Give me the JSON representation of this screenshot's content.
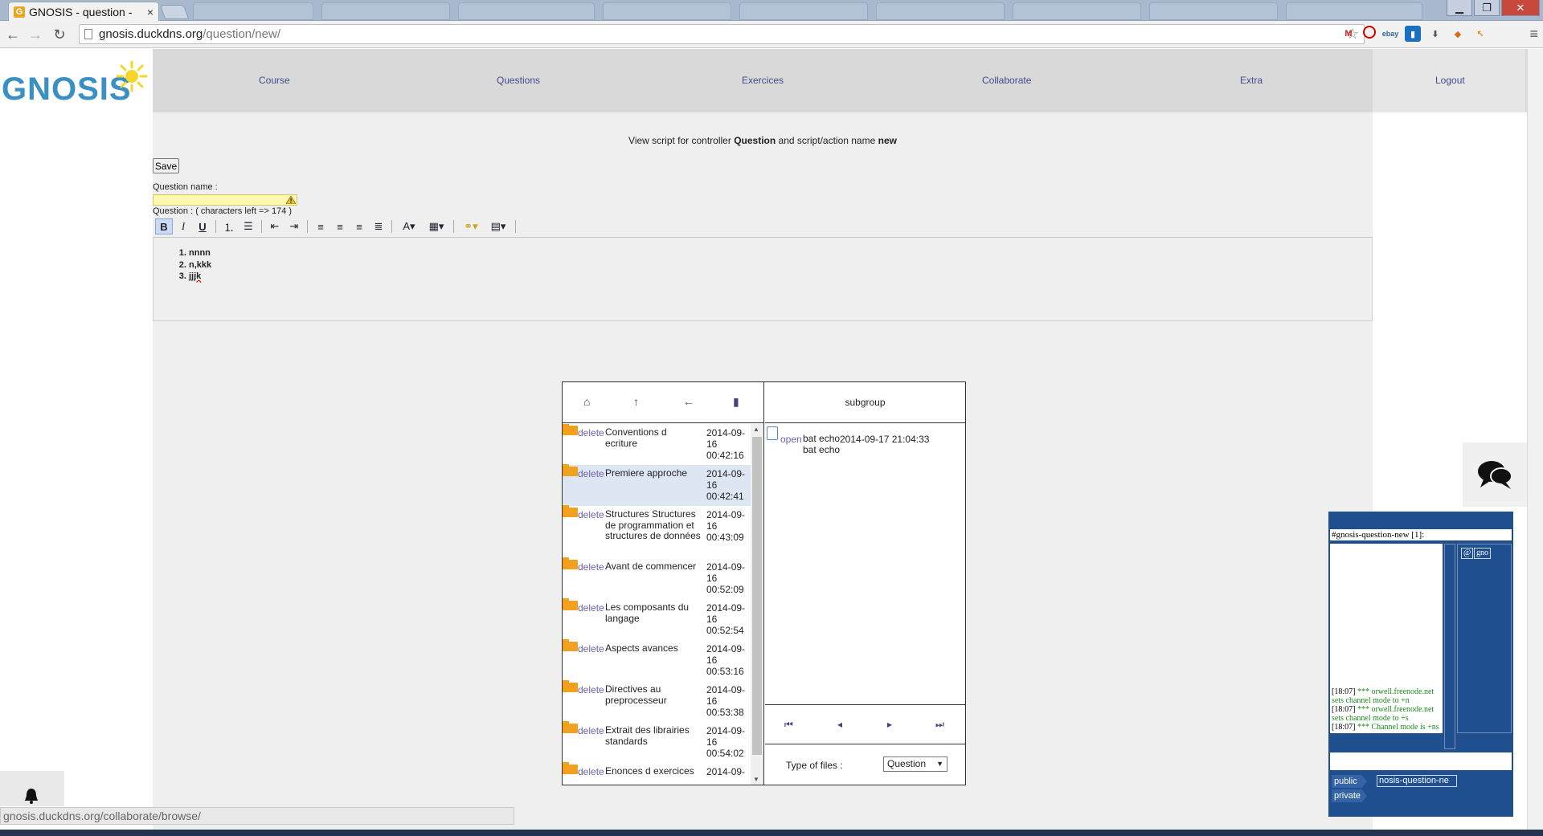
{
  "browser": {
    "tab_title": "GNOSIS - question -",
    "tab_favicon": "G",
    "close_glyph": "×",
    "url_host": "gnosis.duckdns.org",
    "url_path": "/question/new/",
    "status_url": "gnosis.duckdns.org/collaborate/browse/"
  },
  "logo": {
    "text": "GNOSIS"
  },
  "nav": {
    "items": [
      "Course",
      "Questions",
      "Exercices",
      "Collaborate",
      "Extra"
    ],
    "logout": "Logout"
  },
  "main": {
    "controller_prefix": "View script for controller ",
    "controller_name": "Question",
    "controller_mid": " and script/action name ",
    "action_name": "new",
    "save_label": "Save",
    "question_name_label": "Question name :",
    "question_name_value": "",
    "question_label": "Question : ( characters left => 174 )",
    "editor_items": [
      "nnnn",
      "n,kkk",
      "jjjk"
    ]
  },
  "file_browser": {
    "folders": [
      {
        "action": "delete",
        "name": "Conventions d ecriture",
        "date": "2014-09-16 00:42:16"
      },
      {
        "action": "delete",
        "name": "Premiere approche",
        "date": "2014-09-16 00:42:41"
      },
      {
        "action": "delete",
        "name": "Structures Structures de programmation et structures de données",
        "date": "2014-09-16 00:43:09"
      },
      {
        "action": "delete",
        "name": "Avant de commencer",
        "date": "2014-09-16 00:52:09"
      },
      {
        "action": "delete",
        "name": "Les composants du langage",
        "date": "2014-09-16 00:52:54"
      },
      {
        "action": "delete",
        "name": "Aspects avances",
        "date": "2014-09-16 00:53:16"
      },
      {
        "action": "delete",
        "name": "Directives au preprocesseur",
        "date": "2014-09-16 00:53:38"
      },
      {
        "action": "delete",
        "name": "Extrait des librairies standards",
        "date": "2014-09-16 00:54:02"
      },
      {
        "action": "delete",
        "name": "Enonces d exercices",
        "date": "2014-09-"
      }
    ],
    "subgroup_label": "subgroup",
    "file": {
      "action": "open",
      "name": "bat echo bat echo",
      "date": "2014-09-17 21:04:33"
    },
    "type_label": "Type of files :",
    "type_value": "Question"
  },
  "irc": {
    "channel_title": "#gnosis-question-new [1]:",
    "messages": [
      {
        "time": "[18:07]",
        "text": "*** orwell.freenode.net sets channel mode to +n"
      },
      {
        "time": "[18:07]",
        "text": "*** orwell.freenode.net sets channel mode to +s"
      },
      {
        "time": "[18:07]",
        "text": "*** Channel mode is +ns"
      }
    ],
    "nick_at": "@",
    "nick_name": "gno",
    "tab_public": "public",
    "tab_private": "private",
    "channel_box": "nosis-question-ne"
  }
}
